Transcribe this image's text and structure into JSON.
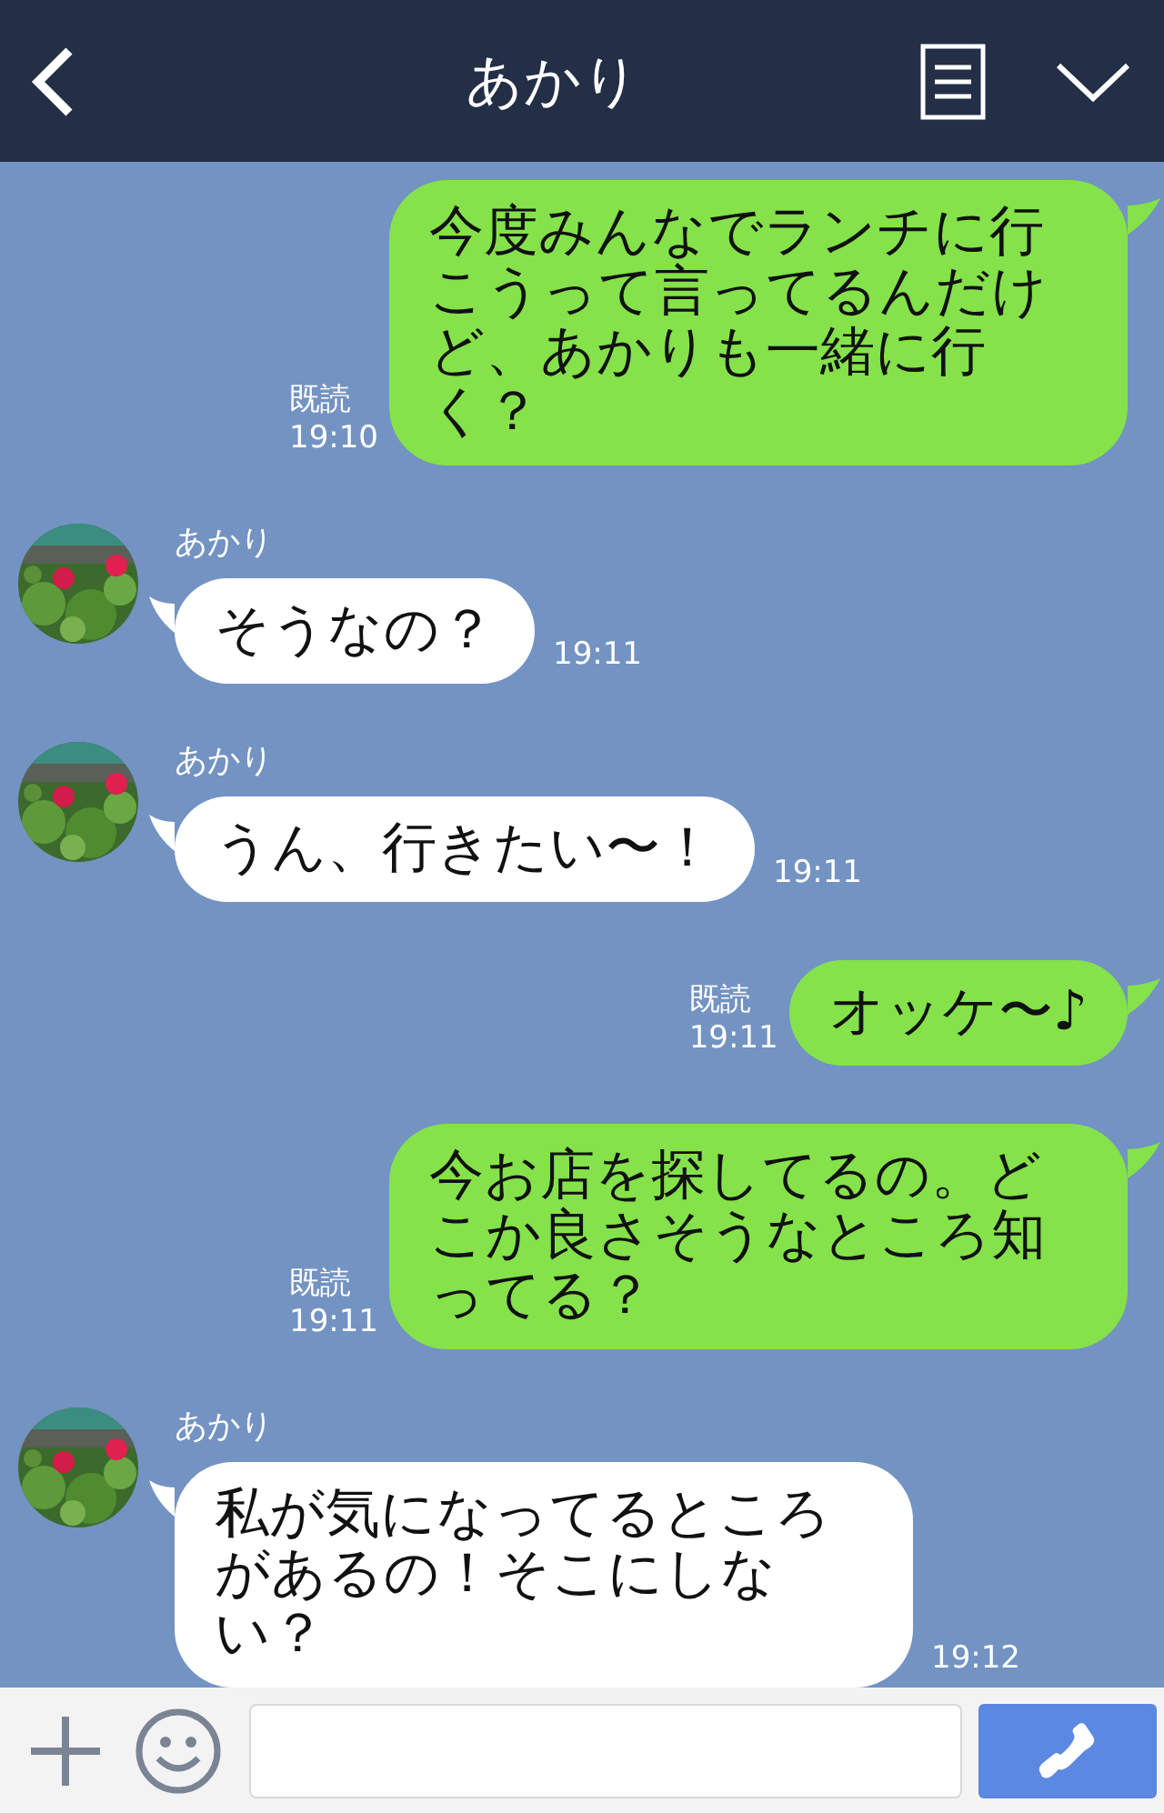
{
  "header": {
    "title": "あかり"
  },
  "messages": [
    {
      "kind": "sent",
      "read_label": "既読",
      "time": "19:10",
      "text": "今度みんなでランチに行こうって言ってるんだけど、あかりも一緒に行く？"
    },
    {
      "kind": "received",
      "sender": "あかり",
      "text": "そうなの？",
      "time": "19:11"
    },
    {
      "kind": "received",
      "sender": "あかり",
      "text": "うん、行きたい〜！",
      "time": "19:11"
    },
    {
      "kind": "sent",
      "read_label": "既読",
      "time": "19:11",
      "text": "オッケ〜♪"
    },
    {
      "kind": "sent",
      "read_label": "既読",
      "time": "19:11",
      "text": "今お店を探してるの。どこか良さそうなところ知ってる？"
    },
    {
      "kind": "received",
      "sender": "あかり",
      "text": "私が気になってるところがあるの！そこにしない？",
      "time": "19:12"
    }
  ]
}
